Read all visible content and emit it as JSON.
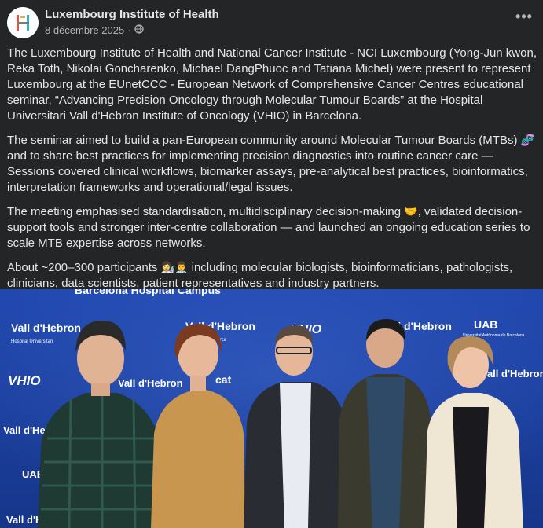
{
  "post": {
    "author": "Luxembourg Institute of Health",
    "date": "8 décembre 2025",
    "separator": "·",
    "more_label": "•••",
    "paragraphs": [
      {
        "text": "The Luxembourg Institute of Health and National Cancer Institute - NCI Luxembourg (Yong-Jun kwon, Reka Toth, Nikolai Goncharenko, Michael DangPhuoc and Tatiana Michel) were present to represent Luxembourg at the EUnetCCC - European Network of Comprehensive Cancer Centres educational seminar, “Advancing Precision Oncology through Molecular Tumour Boards” at the Hospital Universitari Vall d'Hebron Institute of Oncology (VHIO) in Barcelona.",
        "emoji": "",
        "tail": ""
      },
      {
        "text": "The seminar aimed to build a pan-European community around Molecular Tumour Boards (MTBs) ",
        "emoji": "🧬",
        "tail": " and to share best practices for implementing precision diagnostics into routine cancer care — Sessions covered clinical workflows, biomarker assays, pre-analytical best practices, bioinformatics, interpretation frameworks and operational/legal issues."
      },
      {
        "text": "The meeting emphasised standardisation, multidisciplinary decision-making ",
        "emoji": "🤝",
        "tail": ", validated decision-support tools and stronger inter-centre collaboration — and launched an ongoing education series to scale MTB expertise across networks."
      },
      {
        "text": "About ~200–300 participants ",
        "emoji": "👩‍🔬👨‍⚕️",
        "tail": " including molecular biologists, bioinformaticians, pathologists, clinicians, data scientists, patient representatives and industry partners."
      }
    ]
  },
  "photo": {
    "backdrop_texts": {
      "top_banner": "Barcelona Hospital Campus",
      "vall1": "Vall d'Hebron",
      "vall1_sub": "Hospital Universitari",
      "vhio1": "VHIO",
      "uab": "UAB",
      "uab_sub": "Universitat Autònoma de Barcelona",
      "cat": "cat",
      "vall_small": "Vall d'Hebron",
      "vall_small_sub": "Institut de Recerca"
    },
    "colors": {
      "backdrop": "#1d3f9e",
      "banner_text": "#ffffff"
    }
  }
}
